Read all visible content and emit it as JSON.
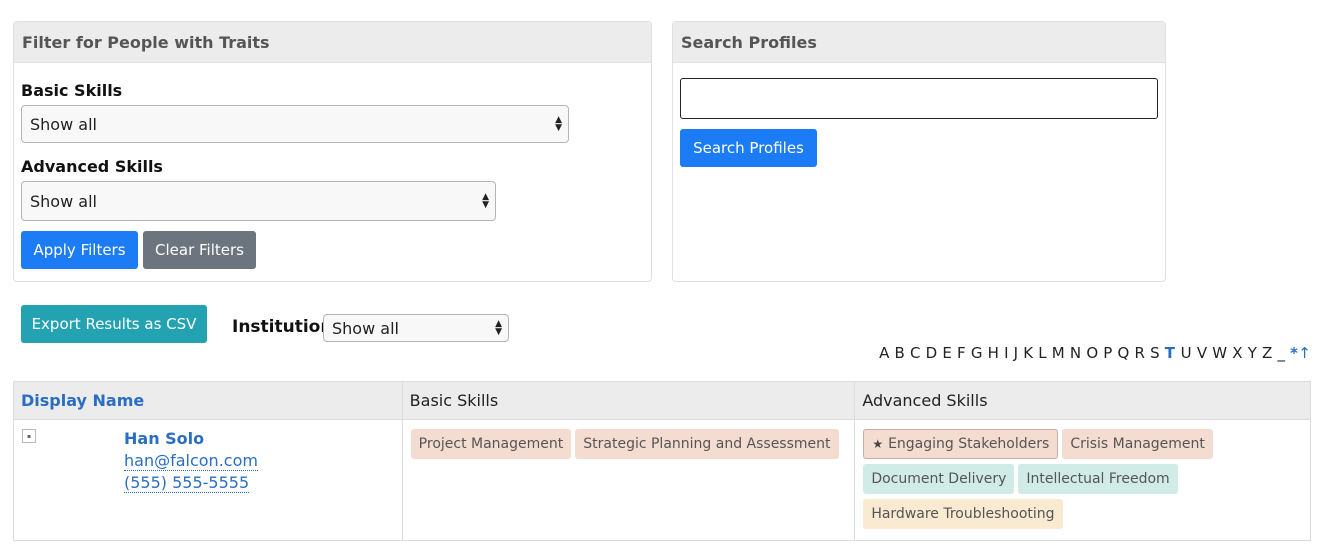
{
  "filter_panel": {
    "title": "Filter for People with Traits",
    "basic_label": "Basic Skills",
    "basic_value": "Show all",
    "advanced_label": "Advanced Skills",
    "advanced_value": "Show all",
    "apply_label": "Apply Filters",
    "clear_label": "Clear Filters"
  },
  "search_panel": {
    "title": "Search Profiles",
    "query": "",
    "button_label": "Search Profiles"
  },
  "toolbar": {
    "export_label": "Export Results as CSV",
    "institution_label": "Institution",
    "institution_value": "Show all"
  },
  "alphabet": {
    "letters": [
      "A",
      "B",
      "C",
      "D",
      "E",
      "F",
      "G",
      "H",
      "I",
      "J",
      "K",
      "L",
      "M",
      "N",
      "O",
      "P",
      "Q",
      "R",
      "S",
      "T",
      "U",
      "V",
      "W",
      "X",
      "Y",
      "Z",
      "_"
    ],
    "active": "T",
    "all_label": "*",
    "up_label": "↑"
  },
  "table": {
    "headers": {
      "display_name": "Display Name",
      "basic_skills": "Basic Skills",
      "advanced_skills": "Advanced Skills"
    },
    "rows": [
      {
        "name": "Han Solo",
        "email": "han@falcon.com",
        "phone": "(555) 555-5555",
        "basic_skills": [
          "Project Management",
          "Strategic Planning and Assessment"
        ],
        "advanced_skills": [
          {
            "label": "Engaging Stakeholders",
            "starred": true,
            "color": "#f5dcd1"
          },
          {
            "label": "Crisis Management",
            "starred": false,
            "color": "#f5dcd1"
          },
          {
            "label": "Document Delivery",
            "starred": false,
            "color": "#d1ece7"
          },
          {
            "label": "Intellectual Freedom",
            "starred": false,
            "color": "#d1ece7"
          },
          {
            "label": "Hardware Troubleshooting",
            "starred": false,
            "color": "#f9ead1"
          }
        ]
      }
    ]
  },
  "colors": {
    "primary": "#1b7cf5",
    "secondary": "#6c757d",
    "info": "#23a2b2",
    "link": "#2a6ec2"
  }
}
